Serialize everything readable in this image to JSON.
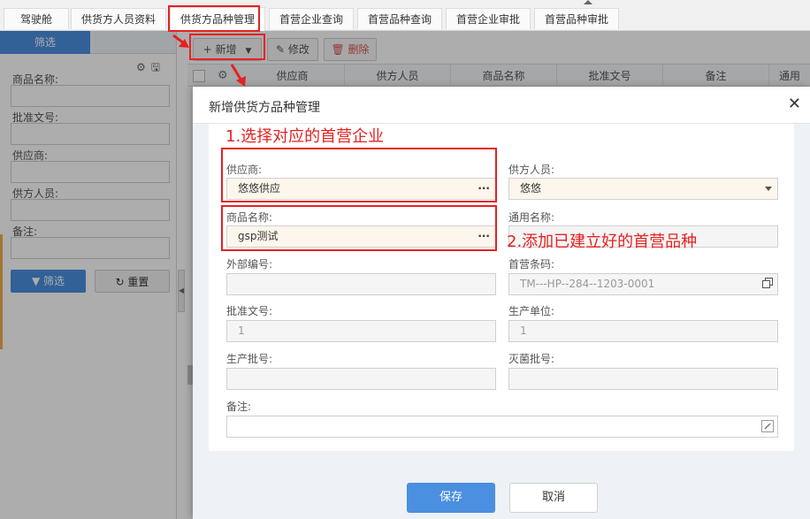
{
  "tabs": [
    {
      "label": "驾驶舱"
    },
    {
      "label": "供货方人员资料"
    },
    {
      "label": "供货方品种管理"
    },
    {
      "label": "首营企业查询"
    },
    {
      "label": "首营品种查询"
    },
    {
      "label": "首营企业审批"
    },
    {
      "label": "首营品种审批"
    }
  ],
  "active_tab": "供货方品种管理",
  "left_panel": {
    "tab_filter": "筛选",
    "fields": [
      {
        "label": "商品名称:"
      },
      {
        "label": "批准文号:"
      },
      {
        "label": "供应商:"
      },
      {
        "label": "供方人员:"
      },
      {
        "label": "备注:"
      }
    ],
    "btn_filter": "筛选",
    "btn_reset": "重置"
  },
  "toolbar": {
    "add": "新增",
    "edit": "修改",
    "delete": "删除"
  },
  "grid": {
    "columns": [
      "供应商",
      "供方人员",
      "商品名称",
      "批准文号",
      "备注",
      "通用"
    ]
  },
  "dialog": {
    "title": "新增供货方品种管理",
    "fields": {
      "supplier": {
        "label": "供应商:",
        "value": "悠悠供应"
      },
      "supplier_person": {
        "label": "供方人员:",
        "value": "悠悠"
      },
      "product_name": {
        "label": "商品名称:",
        "value": "gsp测试"
      },
      "common_name": {
        "label": "通用名称:",
        "value": ""
      },
      "external_code": {
        "label": "外部编号:",
        "value": ""
      },
      "first_code": {
        "label": "首营条码:",
        "value": "TM---HP--284--1203-0001"
      },
      "approval_no": {
        "label": "批准文号:",
        "value": "1"
      },
      "production_unit": {
        "label": "生产单位:",
        "value": "1"
      },
      "production_batch": {
        "label": "生产批号:",
        "value": ""
      },
      "sterilization_batch": {
        "label": "灭菌批号:",
        "value": ""
      },
      "remark": {
        "label": "备注:",
        "value": ""
      }
    },
    "save": "保存",
    "cancel": "取消"
  },
  "annotations": {
    "step1": "1.选择对应的首营企业",
    "step2": "2.添加已建立好的首营品种"
  },
  "colors": {
    "primary": "#4a8fe0",
    "annotation_red": "#e52222",
    "active_field_bg": "#fdf6ec"
  }
}
